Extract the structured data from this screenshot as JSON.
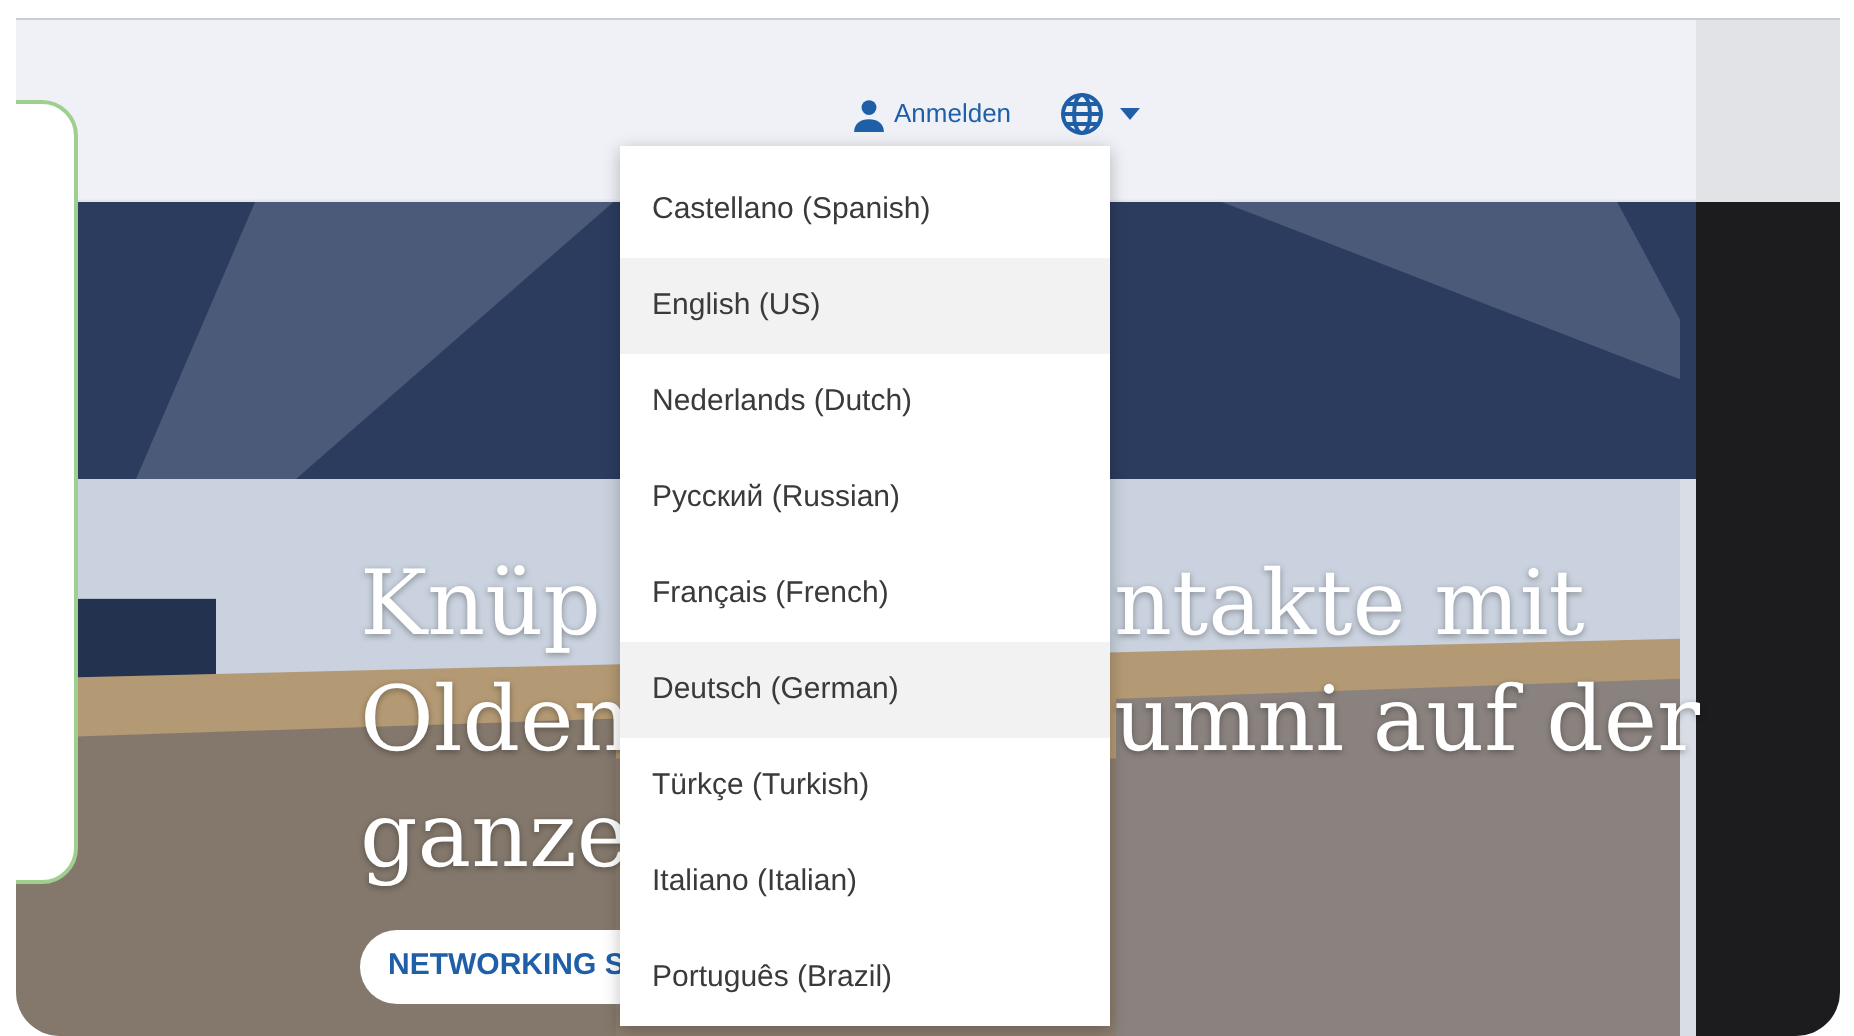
{
  "header": {
    "login": "Anmelden"
  },
  "hero": {
    "headline": [
      {
        "left": "Knüp",
        "right": "ntakte mit"
      },
      {
        "left": "Olden",
        "right": "umni auf der"
      },
      {
        "left": "ganze"
      }
    ],
    "button": "NETWORKING S"
  },
  "language_menu": [
    {
      "label": "Castellano (Spanish)",
      "highlighted": false
    },
    {
      "label": "English (US)",
      "highlighted": true
    },
    {
      "label": "Nederlands (Dutch)",
      "highlighted": false
    },
    {
      "label": "Русский (Russian)",
      "highlighted": false
    },
    {
      "label": "Français (French)",
      "highlighted": false
    },
    {
      "label": "Deutsch (German)",
      "highlighted": true
    },
    {
      "label": "Türkçe (Turkish)",
      "highlighted": false
    },
    {
      "label": "Italiano (Italian)",
      "highlighted": false
    },
    {
      "label": "Português (Brazil)",
      "highlighted": false
    }
  ]
}
